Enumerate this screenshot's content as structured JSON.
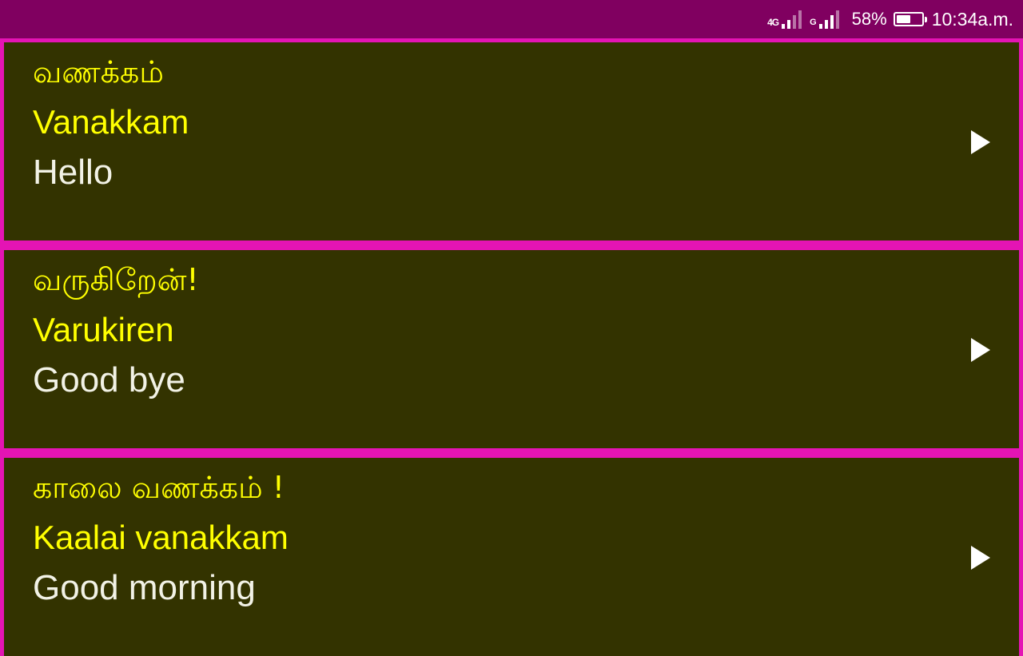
{
  "status_bar": {
    "network_1": "4G",
    "network_2": "G",
    "battery_percent": "58%",
    "battery_level": 0.58,
    "time": "10:34a.m."
  },
  "phrases": [
    {
      "native": "வணக்கம்",
      "transliteration": "Vanakkam",
      "english": "Hello"
    },
    {
      "native": "வருகிறேன்!",
      "transliteration": "Varukiren",
      "english": "Good bye"
    },
    {
      "native": "காலை வணக்கம் !",
      "transliteration": "Kaalai vanakkam",
      "english": "Good morning"
    }
  ],
  "colors": {
    "status_bar_bg": "#800060",
    "divider": "#e414b4",
    "card_bg": "#333300",
    "native_text": "#ffff00",
    "english_text": "#f2f2e6"
  },
  "icons": {
    "play": "play-icon"
  }
}
